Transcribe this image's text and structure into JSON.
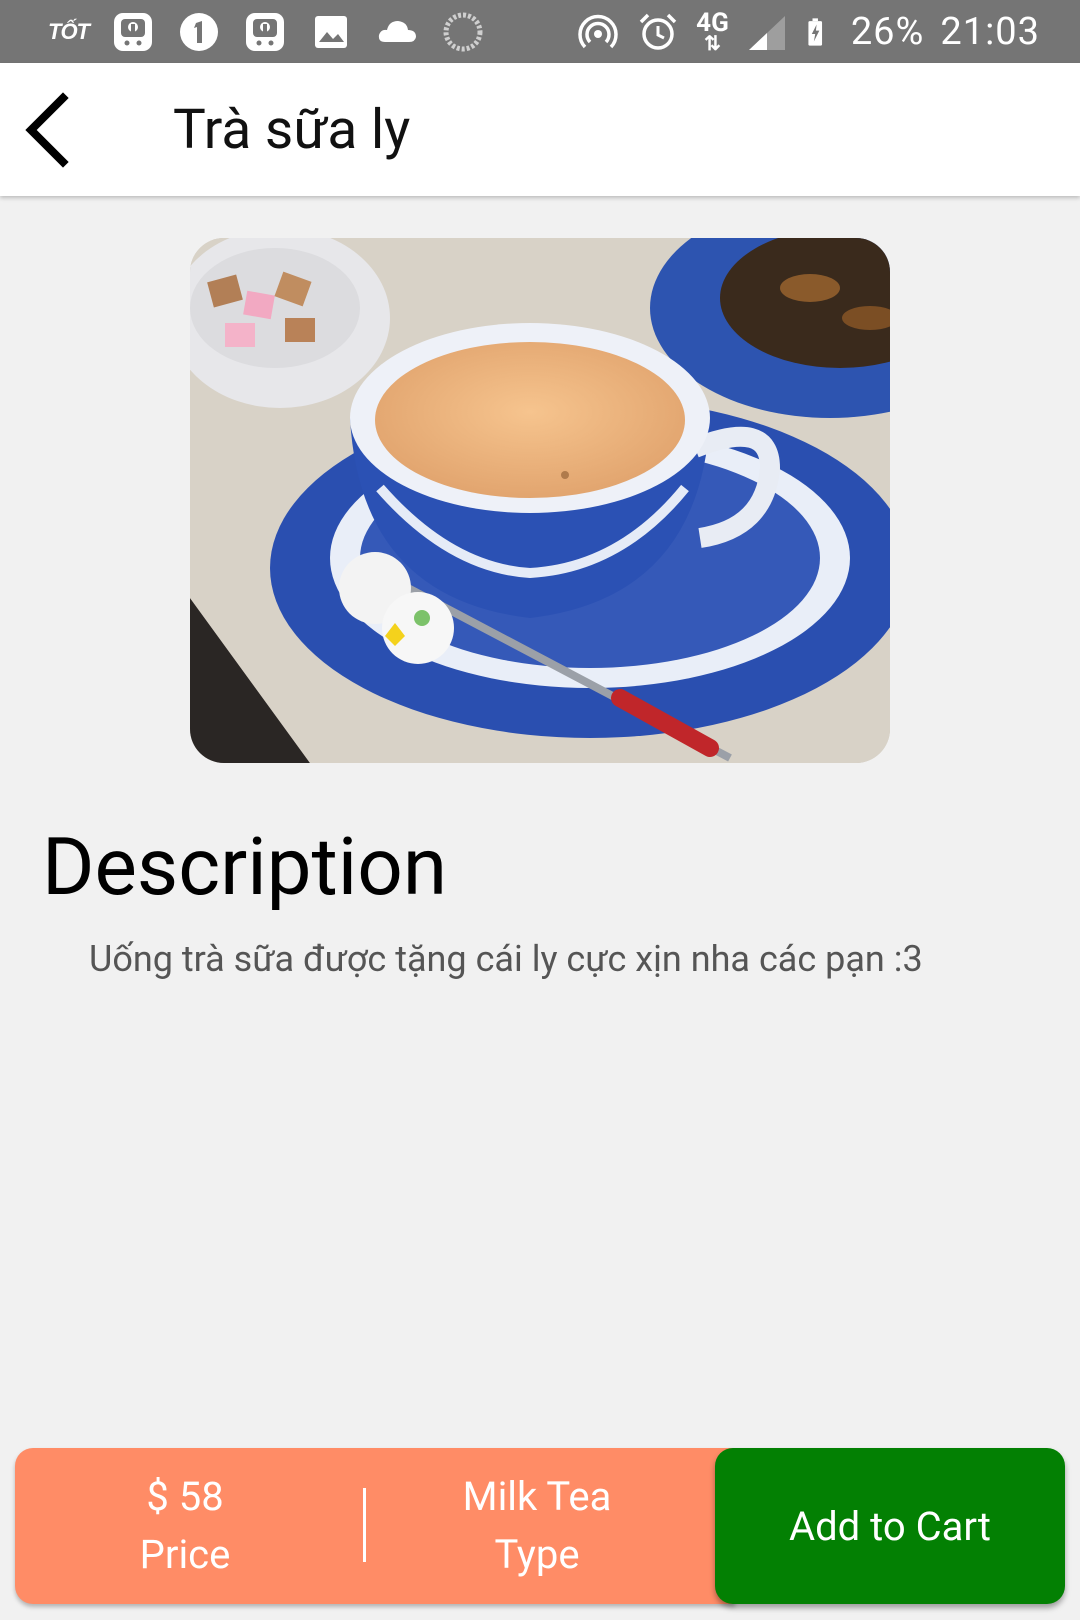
{
  "status_bar": {
    "app_badge": "TỐT",
    "battery": "26%",
    "time": "21:03",
    "network": "4G"
  },
  "header": {
    "title": "Trà sữa ly"
  },
  "product": {
    "image_alt": "cup of milk tea"
  },
  "description": {
    "heading": "Description",
    "text": "Uống trà sữa được tặng cái ly cực xịn nha các pạn :3"
  },
  "bottom_bar": {
    "price_value": "$ 58",
    "price_label": "Price",
    "type_value": "Milk Tea",
    "type_label": "Type",
    "cart_label": "Add to Cart"
  },
  "colors": {
    "status_bar": "#757575",
    "info_panel": "#ff8c66",
    "cart_button": "#038003"
  }
}
